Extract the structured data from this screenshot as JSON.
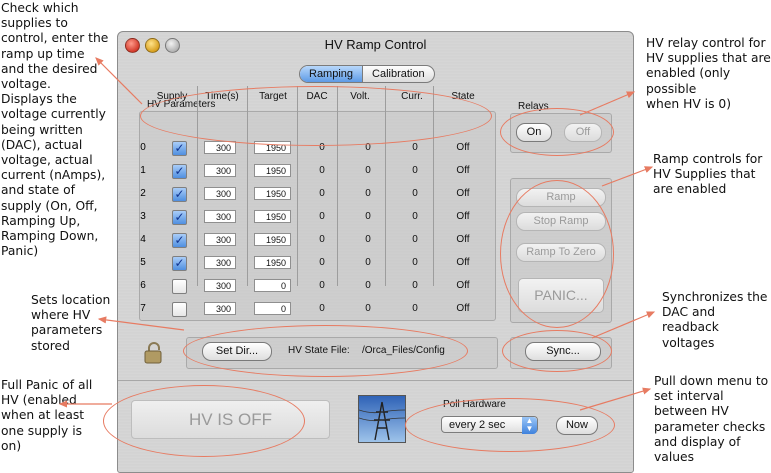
{
  "annotations": {
    "top_left": [
      "Check which",
      "supplies to",
      "control, enter the",
      "ramp up time",
      "and the desired",
      "voltage.",
      "Displays the",
      "voltage currently",
      "being written",
      "(DAC), actual",
      "voltage, actual",
      "current (nAmps),",
      "and state of",
      "supply (On, Off,",
      "Ramping Up,",
      "Ramping Down,",
      "Panic)"
    ],
    "mid_left": [
      "Sets location",
      "where HV",
      "parameters",
      "stored"
    ],
    "bottom_left": [
      "Full Panic of all",
      "HV (enabled",
      "when at least",
      "one supply is",
      "on)"
    ],
    "relay": [
      "HV relay control for",
      "HV supplies that are",
      "enabled (only possible",
      "when HV is 0)"
    ],
    "ramp": [
      "Ramp controls for",
      "HV Supplies that",
      "are enabled"
    ],
    "sync": [
      "Synchronizes the",
      "DAC and readback",
      "voltages"
    ],
    "poll": [
      "Pull down menu to",
      "set interval",
      "between HV",
      "parameter checks",
      "and display of",
      "values"
    ]
  },
  "window": {
    "title": "HV Ramp Control",
    "tabs": [
      {
        "label": "Ramping",
        "selected": true
      },
      {
        "label": "Calibration",
        "selected": false
      }
    ]
  },
  "hv_parameters": {
    "label": "HV Parameters",
    "columns": [
      "Supply",
      "Time(s)",
      "Target",
      "DAC",
      "Volt.",
      "Curr.",
      "State"
    ],
    "rows": [
      {
        "index": "0",
        "checked": true,
        "time": "300",
        "target": "1950",
        "dac": "0",
        "volt": "0",
        "curr": "0",
        "state": "Off"
      },
      {
        "index": "1",
        "checked": true,
        "time": "300",
        "target": "1950",
        "dac": "0",
        "volt": "0",
        "curr": "0",
        "state": "Off"
      },
      {
        "index": "2",
        "checked": true,
        "time": "300",
        "target": "1950",
        "dac": "0",
        "volt": "0",
        "curr": "0",
        "state": "Off"
      },
      {
        "index": "3",
        "checked": true,
        "time": "300",
        "target": "1950",
        "dac": "0",
        "volt": "0",
        "curr": "0",
        "state": "Off"
      },
      {
        "index": "4",
        "checked": true,
        "time": "300",
        "target": "1950",
        "dac": "0",
        "volt": "0",
        "curr": "0",
        "state": "Off"
      },
      {
        "index": "5",
        "checked": true,
        "time": "300",
        "target": "1950",
        "dac": "0",
        "volt": "0",
        "curr": "0",
        "state": "Off"
      },
      {
        "index": "6",
        "checked": false,
        "time": "300",
        "target": "0",
        "dac": "0",
        "volt": "0",
        "curr": "0",
        "state": "Off"
      },
      {
        "index": "7",
        "checked": false,
        "time": "300",
        "target": "0",
        "dac": "0",
        "volt": "0",
        "curr": "0",
        "state": "Off"
      }
    ]
  },
  "relays": {
    "label": "Relays",
    "on": "On",
    "off": "Off"
  },
  "ramp_controls": {
    "ramp": "Ramp",
    "stop": "Stop Ramp",
    "zero": "Ramp To Zero",
    "panic": "PANIC..."
  },
  "file": {
    "set_dir": "Set Dir...",
    "state_label": "HV State File:",
    "path": "/Orca_Files/Config"
  },
  "sync": "Sync...",
  "hv_status": "HV IS OFF",
  "poll": {
    "label": "Poll Hardware",
    "selected": "every 2 sec",
    "now": "Now"
  },
  "colors": {
    "annotation": "#e77b62",
    "accent": "#3f82dd"
  }
}
